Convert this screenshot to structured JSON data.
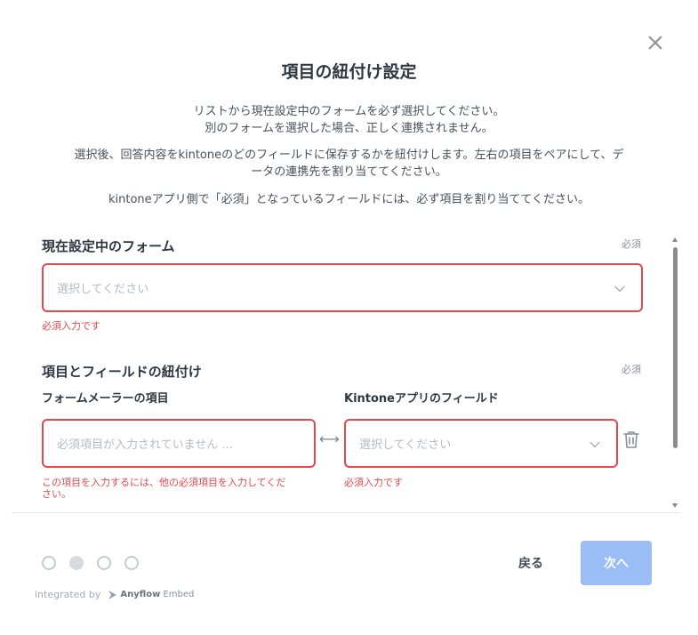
{
  "dialog": {
    "title": "項目の紐付け設定",
    "desc1_line1": "リストから現在設定中のフォームを必ず選択してください。",
    "desc1_line2": "別のフォームを選択した場合、正しく連携されません。",
    "desc2_line1": "選択後、回答内容をkintoneのどのフィールドに保存するかを紐付けします。左右の項目をペアにして、デ",
    "desc2_line2": "ータの連携先を割り当ててください。",
    "desc3": "kintoneアプリ側で「必須」となっているフィールドには、必ず項目を割り当ててください。"
  },
  "form_section": {
    "label": "現在設定中のフォーム",
    "required": "必須",
    "select_placeholder": "選択してください",
    "error": "必須入力です"
  },
  "mapping_section": {
    "label": "項目とフィールドの紐付け",
    "required": "必須",
    "left_label": "フォームメーラーの項目",
    "right_label": "Kintoneアプリのフィールド",
    "left_placeholder": "必須項目が入力されていません ...",
    "right_placeholder": "選択してください",
    "left_error_line1": "この項目を入力するには、他の必須項目を入力してくだ",
    "left_error_line2": "さい。",
    "right_error": "必須入力です",
    "pair_symbol": "⟷"
  },
  "nav": {
    "back_label": "戻る",
    "next_label": "次へ",
    "step_count": 4,
    "current_step": 2
  },
  "footer": {
    "integrated_by": "integrated by",
    "brand_bold": "Anyflow",
    "brand_rest": " Embed"
  },
  "icons": {
    "close": "close-icon",
    "chevron": "chevron-down-icon",
    "trash": "trash-icon",
    "pair": "pair-arrows-icon"
  },
  "colors": {
    "error": "#e5484d",
    "primary_disabled": "#99bdf4",
    "text": "#2f3740"
  }
}
